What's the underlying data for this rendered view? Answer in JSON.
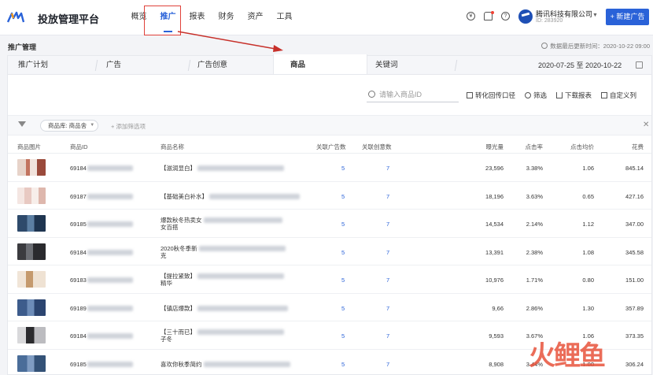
{
  "app": {
    "brand": "投放管理平台"
  },
  "nav": [
    "概览",
    "推广",
    "报表",
    "财务",
    "资产",
    "工具"
  ],
  "header": {
    "company": "腾讯科技有限公司",
    "company_id": "ID: 283920",
    "new_button": "+ 新建广告"
  },
  "page": {
    "title": "推广管理",
    "update_time": "数据最后更新时间：2020-10-22 09:00"
  },
  "tabs": [
    "推广计划",
    "广告",
    "广告创意",
    "商品",
    "关键词"
  ],
  "date_range": "2020-07-25 至 2020-10-22",
  "search": {
    "placeholder": "请输入商品ID"
  },
  "toolbar": [
    "转化回传口径",
    "筛选",
    "下载报表",
    "自定义列"
  ],
  "filter": {
    "chip": "商品库: 商品舍",
    "add": "+ 添加筛选项"
  },
  "table": {
    "columns": [
      "商品图片",
      "商品ID",
      "商品名称",
      "关联广告数",
      "关联创意数",
      "曝光量",
      "点击率",
      "点击均价",
      "花费"
    ],
    "rows": [
      {
        "id": "69184",
        "name": "【滋润显白】",
        "ads": "5",
        "creatives": "7",
        "impressions": "23,596",
        "ctr": "3.38%",
        "cpc": "1.06",
        "cost": "845.14"
      },
      {
        "id": "69187",
        "name": "【基础美白补水】",
        "ads": "5",
        "creatives": "7",
        "impressions": "18,196",
        "ctr": "3.63%",
        "cpc": "0.65",
        "cost": "427.16"
      },
      {
        "id": "69185",
        "name": "爆款秋冬热卖女",
        "name2": "女百搭",
        "ads": "5",
        "creatives": "7",
        "impressions": "14,534",
        "ctr": "2.14%",
        "cpc": "1.12",
        "cost": "347.00"
      },
      {
        "id": "69184",
        "name": "2020秋冬季新",
        "name2": "克",
        "ads": "5",
        "creatives": "7",
        "impressions": "13,391",
        "ctr": "2.38%",
        "cpc": "1.08",
        "cost": "345.58"
      },
      {
        "id": "69183",
        "name": "【提拉紧致】",
        "name2": "精华",
        "ads": "5",
        "creatives": "7",
        "impressions": "10,976",
        "ctr": "1.71%",
        "cpc": "0.80",
        "cost": "151.00"
      },
      {
        "id": "69189",
        "name": "【镇店爆款】",
        "ads": "5",
        "creatives": "7",
        "impressions": "9,66",
        "ctr": "2.86%",
        "cpc": "1.30",
        "cost": "357.89"
      },
      {
        "id": "69184",
        "name": "【三十而已】",
        "name2": "子冬",
        "ads": "5",
        "creatives": "7",
        "impressions": "9,593",
        "ctr": "3.67%",
        "cpc": "1.06",
        "cost": "373.35"
      },
      {
        "id": "69185",
        "name": "喜欢你秋季简约",
        "ads": "5",
        "creatives": "7",
        "impressions": "8,908",
        "ctr": "3.44%",
        "cpc": "1.00",
        "cost": "306.24"
      }
    ]
  },
  "watermark": "火鲤鱼",
  "colors": {
    "accent": "#2a62d8",
    "annotation": "#e0413a",
    "watermark": "#e8533c"
  }
}
